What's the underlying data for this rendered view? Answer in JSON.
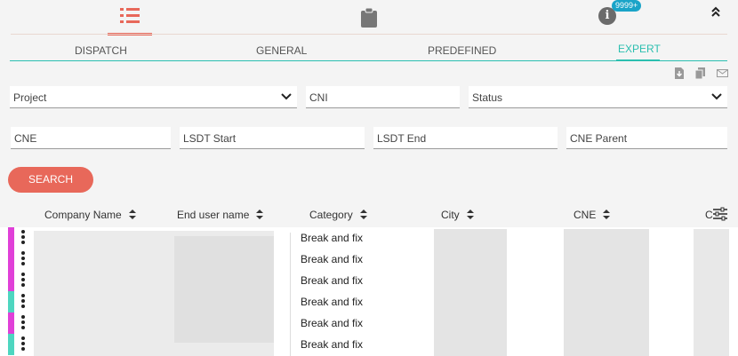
{
  "header": {
    "icons": [
      "list-icon",
      "clipboard-icon",
      "info-icon",
      "collapse-up-icon"
    ],
    "notification_count": "9999+"
  },
  "tabs": [
    {
      "label": "DISPATCH",
      "active": false
    },
    {
      "label": "GENERAL",
      "active": false
    },
    {
      "label": "PREDEFINED",
      "active": false
    },
    {
      "label": "EXPERT",
      "active": true
    }
  ],
  "actions": [
    "download-icon",
    "copy-icon",
    "mail-icon"
  ],
  "filters": {
    "project": {
      "placeholder": "Project",
      "type": "select"
    },
    "cni": {
      "placeholder": "CNI"
    },
    "status": {
      "placeholder": "Status",
      "type": "select"
    },
    "cne": {
      "placeholder": "CNE"
    },
    "lsdt_start": {
      "placeholder": "LSDT Start"
    },
    "lsdt_end": {
      "placeholder": "LSDT End"
    },
    "cne_parent": {
      "placeholder": "CNE Parent"
    }
  },
  "search_button": "SEARCH",
  "table": {
    "columns": [
      "Company Name",
      "End user name",
      "Category",
      "City",
      "CNE",
      "C"
    ],
    "rows": [
      {
        "category": "Break and fix",
        "status_color": "#e040d8"
      },
      {
        "category": "Break and fix",
        "status_color": "#e040d8"
      },
      {
        "category": "Break and fix",
        "status_color": "#e040d8"
      },
      {
        "category": "Break and fix",
        "status_color": "#4ed6c0"
      },
      {
        "category": "Break and fix",
        "status_color": "#e040d8"
      },
      {
        "category": "Break and fix",
        "status_color": "#4ed6c0"
      }
    ]
  },
  "colors": {
    "accent": "#e8685a",
    "tab_active": "#2bbfb0",
    "badge": "#1aa4c8"
  }
}
